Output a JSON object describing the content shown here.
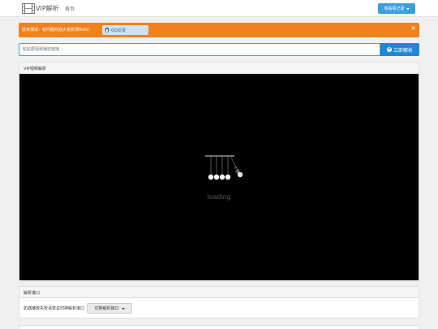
{
  "navbar": {
    "brand": "VIP解析",
    "home": "首页",
    "history_button": "观看看记录"
  },
  "alert": {
    "text": "技术测试：有问题欢迎大家反馈BUG!",
    "qq_button": "QQ反馈",
    "close": "×"
  },
  "search": {
    "placeholder": "粘贴要视频播放链接...",
    "button": "立即解析"
  },
  "player_panel": {
    "title": "VIP视频解析",
    "loading": "loading"
  },
  "source_panel": {
    "title": "解析接口",
    "hint": "如遇播放失败请尝试切换解析接口",
    "switch_button": "切换解析接口"
  },
  "colors": {
    "primary": "#3c9fe0",
    "alert": "#f0821e",
    "player_bg": "#000000"
  }
}
